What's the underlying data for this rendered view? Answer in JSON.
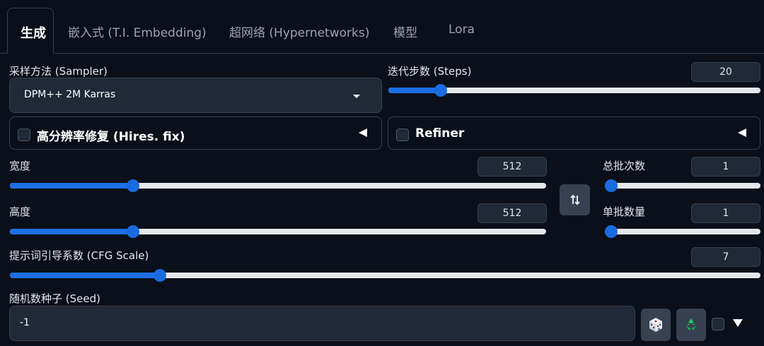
{
  "tabs": [
    {
      "label": "生成",
      "active": true
    },
    {
      "label": "嵌入式 (T.I. Embedding)"
    },
    {
      "label": "超网络 (Hypernetworks)"
    },
    {
      "label": "模型"
    },
    {
      "label": "Lora"
    }
  ],
  "sampler": {
    "label": "采样方法 (Sampler)",
    "value": "DPM++ 2M Karras"
  },
  "steps": {
    "label": "迭代步数 (Steps)",
    "value": "20",
    "fraction": 0.14
  },
  "hires_fix": {
    "label": "高分辨率修复 (Hires. fix)",
    "checked": false
  },
  "refiner": {
    "label": "Refiner",
    "checked": false
  },
  "width": {
    "label": "宽度",
    "value": "512",
    "fraction": 0.23
  },
  "height": {
    "label": "高度",
    "value": "512",
    "fraction": 0.23
  },
  "batch_count": {
    "label": "总批次数",
    "value": "1",
    "fraction": 0.0
  },
  "batch_size": {
    "label": "单批数量",
    "value": "1",
    "fraction": 0.0
  },
  "cfg_scale": {
    "label": "提示词引导系数 (CFG Scale)",
    "value": "7",
    "fraction": 0.2
  },
  "seed": {
    "label": "随机数种子 (Seed)",
    "value": "-1"
  },
  "icons": {
    "swap": "swap-arrows-icon",
    "dice": "dice-icon",
    "recycle": "recycle-icon"
  },
  "colors": {
    "background": "#0b0f19",
    "accent": "#1d6fe6",
    "panel": "#1f2937",
    "recycle": "#22c55e"
  }
}
